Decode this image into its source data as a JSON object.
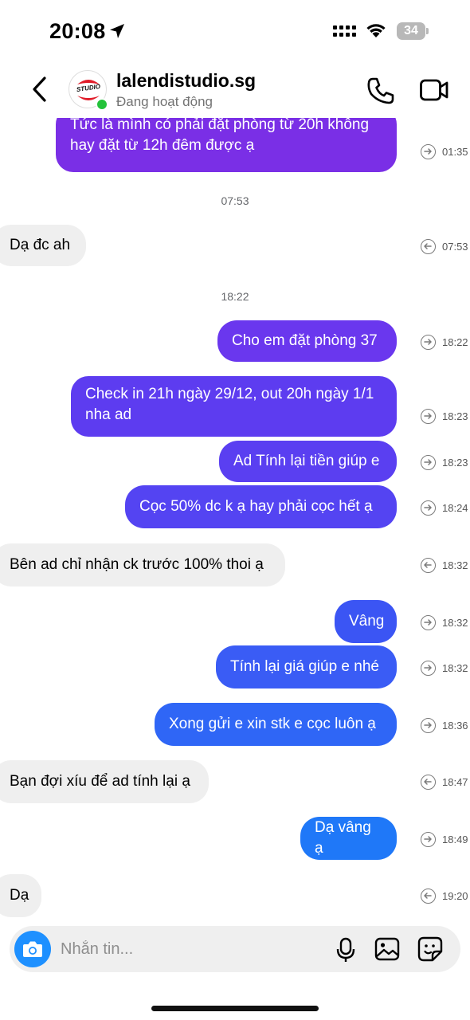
{
  "status_bar": {
    "time": "20:08",
    "battery": "34"
  },
  "header": {
    "name": "lalendistudio.sg",
    "status": "Đang hoạt động",
    "avatar_text": "STUDIO"
  },
  "separators": [
    "07:53",
    "18:22"
  ],
  "messages": [
    {
      "dir": "out",
      "text": "Tức là mình có phải đặt phòng từ 20h không hay đặt từ 12h đêm được ạ",
      "time": "01:35",
      "color": "#7a2fe6"
    },
    {
      "dir": "in",
      "text": "Dạ đc ah",
      "time": "07:53"
    },
    {
      "dir": "out",
      "text": "Cho em đặt phòng 37",
      "time": "18:22",
      "color": "#6a37ee"
    },
    {
      "dir": "out",
      "text": "Check in 21h ngày 29/12, out 20h ngày 1/1 nha ad",
      "time": "18:23",
      "color": "#5d3cf0"
    },
    {
      "dir": "out",
      "text": "Ad Tính lại tiền giúp e",
      "time": "18:23",
      "color": "#5a3ff1"
    },
    {
      "dir": "out",
      "text": "Cọc 50% dc k ạ hay phải cọc hết ạ",
      "time": "18:24",
      "color": "#5444f2"
    },
    {
      "dir": "in",
      "text": "Bên ad chỉ nhận ck trước 100% thoi ạ",
      "time": "18:32"
    },
    {
      "dir": "out",
      "text": "Vâng",
      "time": "18:32",
      "color": "#3b55f4"
    },
    {
      "dir": "out",
      "text": "Tính lại giá giúp e nhé",
      "time": "18:32",
      "color": "#3a5cf5"
    },
    {
      "dir": "out",
      "text": "Xong gửi e xin stk e cọc luôn ạ",
      "time": "18:36",
      "color": "#2f66f6"
    },
    {
      "dir": "in",
      "text": "Bạn đợi xíu để ad tính lại ạ",
      "time": "18:47"
    },
    {
      "dir": "out",
      "text": "Dạ vâng ạ",
      "time": "18:49",
      "color": "#1f78f8"
    },
    {
      "dir": "in",
      "text": "Dạ",
      "time": "19:20"
    }
  ],
  "composer": {
    "placeholder": "Nhắn tin..."
  },
  "colors": {
    "accent": "#1e90ff",
    "online": "#23c23a",
    "incoming_bubble": "#efefef"
  },
  "icons": [
    "back-icon",
    "phone-icon",
    "video-camera-icon",
    "camera-icon",
    "microphone-icon",
    "gallery-icon",
    "sticker-icon",
    "reply-arrow-icon"
  ]
}
